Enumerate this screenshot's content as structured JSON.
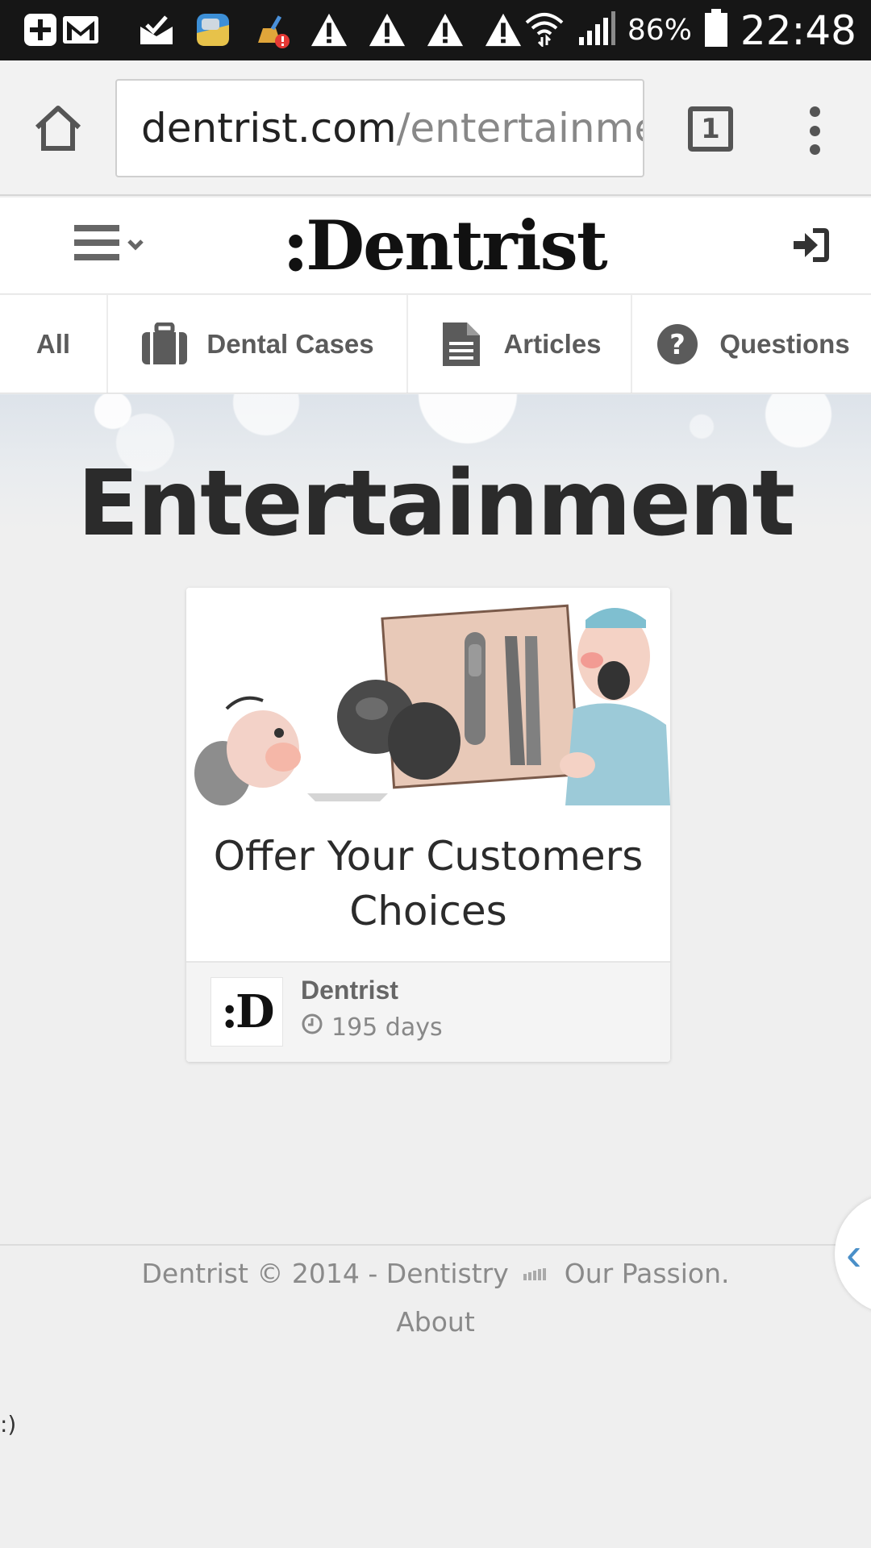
{
  "status_bar": {
    "battery_percent": "86%",
    "time": "22:48",
    "notification_icons": [
      "add-icon",
      "gmail-icon",
      "mail-check-icon",
      "gallery-icon",
      "cleaner-icon",
      "warning-icon",
      "warning-icon",
      "warning-icon",
      "warning-icon"
    ],
    "wifi_icon": "wifi-icon",
    "signal_icon": "signal-icon",
    "battery_icon": "battery-icon"
  },
  "browser": {
    "url_host": "dentrist.com",
    "url_path": "/entertainment",
    "tab_count": "1",
    "home_icon": "home-icon",
    "menu_icon": "overflow-menu-icon"
  },
  "header": {
    "logo_dots": ":",
    "logo_text": "Dentrist",
    "menu_icon": "hamburger-icon",
    "login_icon": "sign-in-icon"
  },
  "categories": [
    {
      "label": "All",
      "icon": ""
    },
    {
      "label": "Dental Cases",
      "icon": "briefcase-icon"
    },
    {
      "label": "Articles",
      "icon": "document-icon"
    },
    {
      "label": "Questions",
      "icon": "question-circle-icon"
    }
  ],
  "page": {
    "title": "Entertainment"
  },
  "card": {
    "title": "Offer Your Customers Choices",
    "author": "Dentrist",
    "age": "195 days",
    "avatar_text": ":D"
  },
  "footer": {
    "copyright": "Dentrist © 2014 - Dentistry",
    "passion": "Our Passion.",
    "about": "About",
    "smiley": ":)"
  },
  "colors": {
    "status_bar": "#161616",
    "title": "#2b2b2b",
    "tab_text": "#5b5b5b",
    "accent_handle": "#4a8fc8"
  }
}
